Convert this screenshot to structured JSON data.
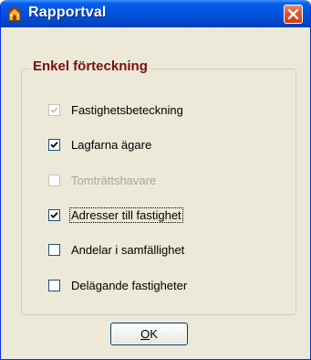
{
  "window": {
    "title": "Rapportval",
    "title_icon": "home-icon",
    "close_icon": "close-icon",
    "title_bar_color": "#0054e3",
    "close_button_color": "#e05a31"
  },
  "group": {
    "legend": "Enkel förteckning",
    "legend_color": "#7a1010"
  },
  "options": [
    {
      "label": "Fastighetsbeteckning",
      "checked": true,
      "enabled": false,
      "focused": false
    },
    {
      "label": "Lagfarna ägare",
      "checked": true,
      "enabled": true,
      "focused": false
    },
    {
      "label": "Tomträttshavare",
      "checked": false,
      "enabled": false,
      "focused": false
    },
    {
      "label": "Adresser till fastighet",
      "checked": true,
      "enabled": true,
      "focused": true
    },
    {
      "label": "Andelar i samfällighet",
      "checked": false,
      "enabled": true,
      "focused": false
    },
    {
      "label": "Delägande fastigheter",
      "checked": false,
      "enabled": true,
      "focused": false
    }
  ],
  "ok_button": {
    "accel": "O",
    "rest": "K"
  }
}
